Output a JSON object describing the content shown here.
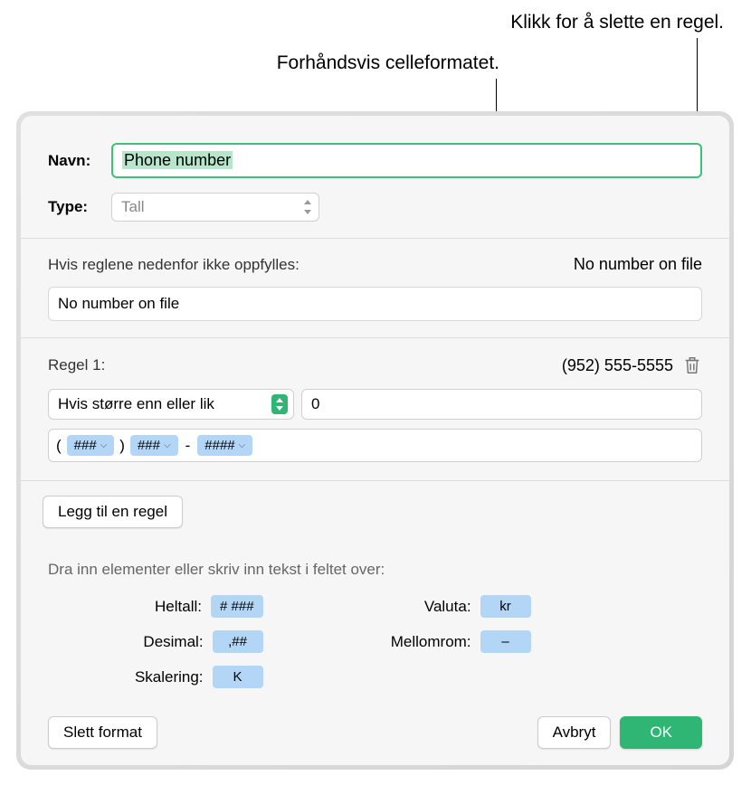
{
  "callouts": {
    "delete_rule": "Klikk for å slette en regel.",
    "preview_format": "Forhåndsvis celleformatet."
  },
  "form": {
    "name_label": "Navn:",
    "name_value": "Phone number",
    "type_label": "Type:",
    "type_value": "Tall"
  },
  "fallback": {
    "label": "Hvis reglene nedenfor ikke oppfylles:",
    "preview": "No number on file",
    "value": "No number on file"
  },
  "rule1": {
    "label": "Regel 1:",
    "preview": "(952) 555-5555",
    "condition": "Hvis større enn eller lik",
    "value": "0",
    "tokens": {
      "t1": "###",
      "t2": "###",
      "t3": "####"
    }
  },
  "add_rule": "Legg til en regel",
  "drag": {
    "label": "Dra inn elementer eller skriv inn tekst i feltet over:",
    "labels": {
      "heltall": "Heltall:",
      "desimal": "Desimal:",
      "skalering": "Skalering:",
      "valuta": "Valuta:",
      "mellomrom": "Mellomrom:"
    },
    "tokens": {
      "heltall": "# ###",
      "desimal": ",##",
      "skalering": "K",
      "valuta": "kr",
      "mellomrom": "–"
    }
  },
  "buttons": {
    "delete_format": "Slett format",
    "cancel": "Avbryt",
    "ok": "OK"
  }
}
